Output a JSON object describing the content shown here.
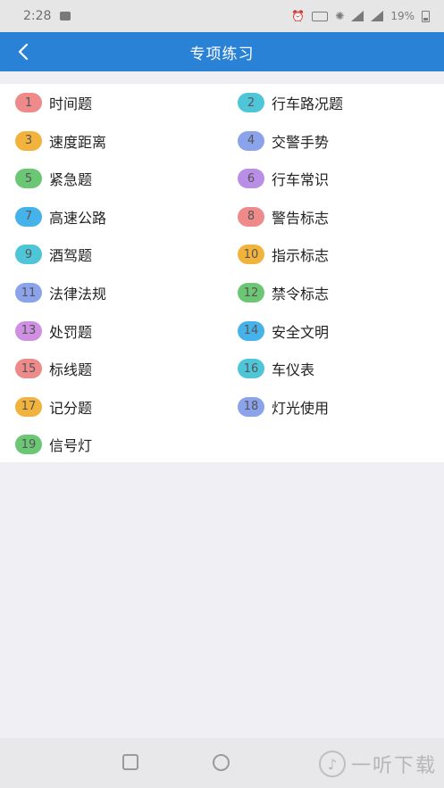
{
  "statusbar": {
    "time": "2:28",
    "battery": "19%"
  },
  "appbar": {
    "title": "专项练习",
    "back_icon": "chevron-left-icon"
  },
  "colors": {
    "primary": "#2a82d6",
    "badge_red": "#ee8a8a",
    "badge_cyan": "#4fc6d8",
    "badge_orange": "#f2b33d",
    "badge_blue": "#8aa3ea",
    "badge_green": "#6cc774",
    "badge_purple": "#b88ee6",
    "badge_lightblue": "#45b2ea",
    "badge_magenta": "#cf8fe3"
  },
  "categories": [
    {
      "num": "1",
      "label": "时间题",
      "color": "#ee8a8a"
    },
    {
      "num": "2",
      "label": "行车路况题",
      "color": "#4fc6d8"
    },
    {
      "num": "3",
      "label": "速度距离",
      "color": "#f2b33d"
    },
    {
      "num": "4",
      "label": "交警手势",
      "color": "#8aa3ea"
    },
    {
      "num": "5",
      "label": "紧急题",
      "color": "#6cc774"
    },
    {
      "num": "6",
      "label": "行车常识",
      "color": "#b88ee6"
    },
    {
      "num": "7",
      "label": "高速公路",
      "color": "#45b2ea"
    },
    {
      "num": "8",
      "label": "警告标志",
      "color": "#ee8a8a"
    },
    {
      "num": "9",
      "label": "酒驾题",
      "color": "#4fc6d8"
    },
    {
      "num": "10",
      "label": "指示标志",
      "color": "#f2b33d"
    },
    {
      "num": "11",
      "label": "法律法规",
      "color": "#8aa3ea"
    },
    {
      "num": "12",
      "label": "禁令标志",
      "color": "#6cc774"
    },
    {
      "num": "13",
      "label": "处罚题",
      "color": "#cf8fe3"
    },
    {
      "num": "14",
      "label": "安全文明",
      "color": "#45b2ea"
    },
    {
      "num": "15",
      "label": "标线题",
      "color": "#ee8a8a"
    },
    {
      "num": "16",
      "label": "车仪表",
      "color": "#4fc6d8"
    },
    {
      "num": "17",
      "label": "记分题",
      "color": "#f2b33d"
    },
    {
      "num": "18",
      "label": "灯光使用",
      "color": "#8aa3ea"
    },
    {
      "num": "19",
      "label": "信号灯",
      "color": "#6cc774"
    }
  ],
  "watermark": {
    "text": "一听下载"
  }
}
